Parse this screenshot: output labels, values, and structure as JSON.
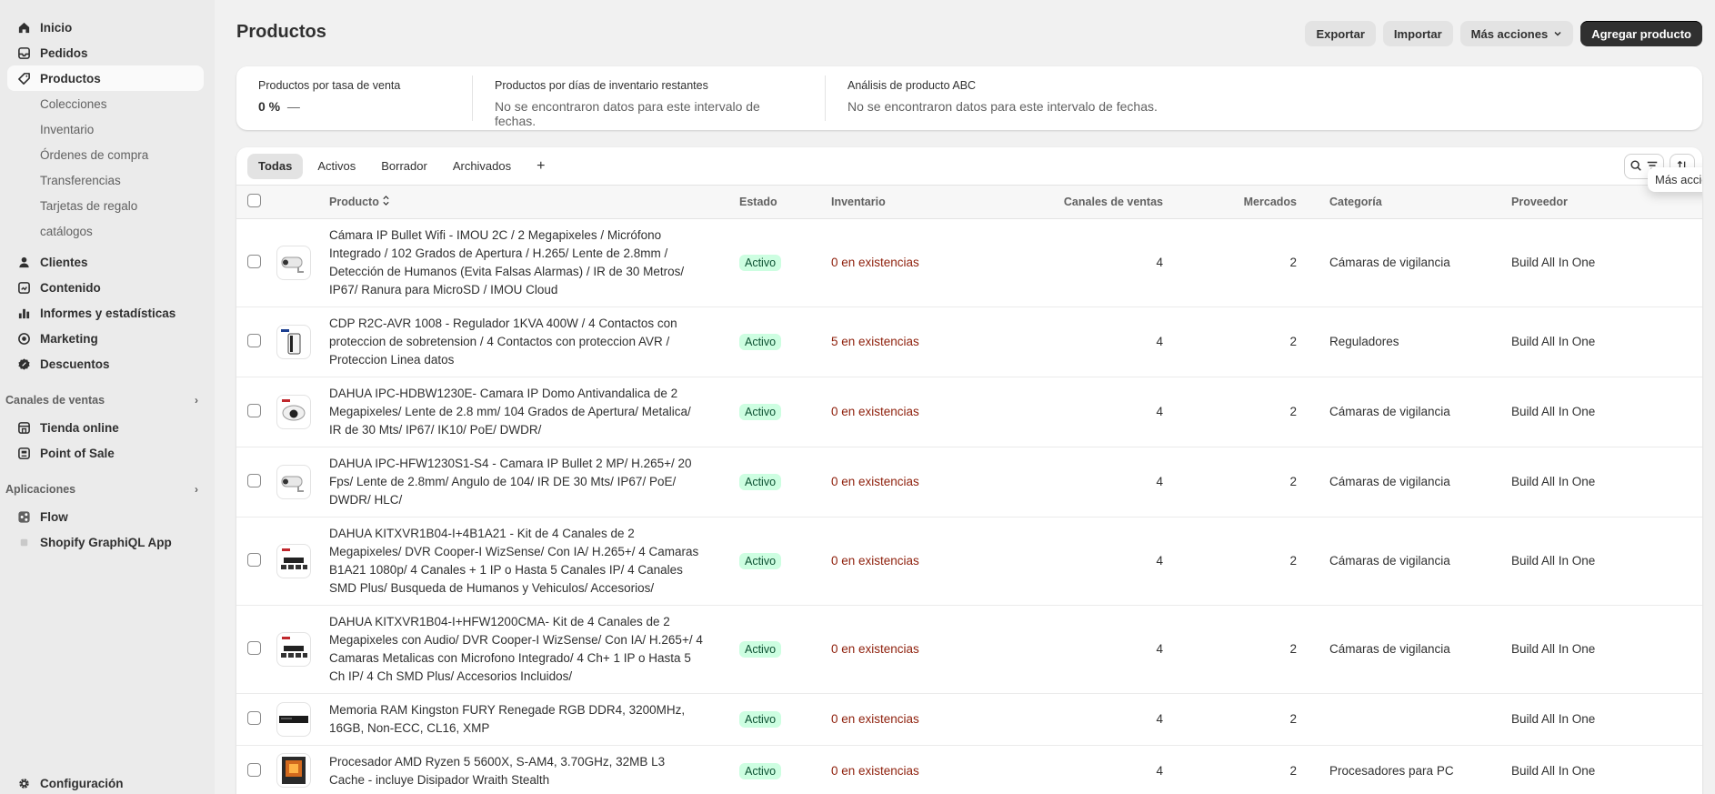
{
  "sidebar": {
    "top": [
      {
        "label": "Inicio",
        "icon": "home-icon"
      },
      {
        "label": "Pedidos",
        "icon": "inbox-icon"
      },
      {
        "label": "Productos",
        "icon": "tag-icon",
        "active": true
      }
    ],
    "products_sub": [
      "Colecciones",
      "Inventario",
      "Órdenes de compra",
      "Transferencias",
      "Tarjetas de regalo",
      "catálogos"
    ],
    "mid": [
      {
        "label": "Clientes",
        "icon": "person-icon"
      },
      {
        "label": "Contenido",
        "icon": "content-icon"
      },
      {
        "label": "Informes y estadísticas",
        "icon": "chart-icon"
      },
      {
        "label": "Marketing",
        "icon": "target-icon"
      },
      {
        "label": "Descuentos",
        "icon": "discount-icon"
      }
    ],
    "sales_channels_label": "Canales de ventas",
    "sales_channels": [
      {
        "label": "Tienda online",
        "icon": "store-icon"
      },
      {
        "label": "Point of Sale",
        "icon": "pos-icon"
      }
    ],
    "apps_label": "Aplicaciones",
    "apps": [
      {
        "label": "Flow",
        "icon": "flow-icon"
      },
      {
        "label": "Shopify GraphiQL App",
        "icon": "app-icon"
      }
    ],
    "settings_label": "Configuración"
  },
  "header": {
    "title": "Productos",
    "export": "Exportar",
    "import": "Importar",
    "more_actions": "Más acciones",
    "add_product": "Agregar producto"
  },
  "stats": {
    "sell_rate_label": "Productos por tasa de venta",
    "sell_rate_value": "0 %",
    "sell_rate_dash": "—",
    "days_label": "Productos por días de inventario restantes",
    "days_value": "No se encontraron datos para este intervalo de fechas.",
    "abc_label": "Análisis de producto ABC",
    "abc_value": "No se encontraron datos para este intervalo de fechas."
  },
  "tabs": [
    "Todas",
    "Activos",
    "Borrador",
    "Archivados",
    "+"
  ],
  "tooltip": "Más acciones",
  "columns": {
    "product": "Producto",
    "status": "Estado",
    "inventory": "Inventario",
    "channels": "Canales de ventas",
    "markets": "Mercados",
    "category": "Categoría",
    "vendor": "Proveedor"
  },
  "rows": [
    {
      "name": "Cámara IP Bullet Wifi - IMOU 2C / 2 Megapixeles / Micrófono Integrado / 102 Grados de Apertura / H.265/ Lente de 2.8mm / Detección de Humanos (Evita Falsas Alarmas) / IR de 30 Metros/ IP67/ Ranura para MicroSD / IMOU Cloud",
      "status": "Activo",
      "inventory": "0 en existencias",
      "channels": "4",
      "markets": "2",
      "category": "Cámaras de vigilancia",
      "vendor": "Build All In One",
      "thumb": "bullet-camera"
    },
    {
      "name": "CDP R2C-AVR 1008 - Regulador 1KVA 400W / 4 Contactos con proteccion de sobretension / 4 Contactos con proteccion AVR / Proteccion Linea datos",
      "status": "Activo",
      "inventory": "5 en existencias",
      "channels": "4",
      "markets": "2",
      "category": "Reguladores",
      "vendor": "Build All In One",
      "thumb": "regulator"
    },
    {
      "name": "DAHUA IPC-HDBW1230E- Camara IP Domo Antivandalica de 2 Megapixeles/ Lente de 2.8 mm/ 104 Grados de Apertura/ Metalica/ IR de 30 Mts/ IP67/ IK10/ PoE/ DWDR/",
      "status": "Activo",
      "inventory": "0 en existencias",
      "channels": "4",
      "markets": "2",
      "category": "Cámaras de vigilancia",
      "vendor": "Build All In One",
      "thumb": "dome-camera"
    },
    {
      "name": "DAHUA IPC-HFW1230S1-S4 - Camara IP Bullet 2 MP/ H.265+/ 20 Fps/ Lente de 2.8mm/ Angulo de 104/ IR DE 30 Mts/ IP67/ PoE/ DWDR/ HLC/",
      "status": "Activo",
      "inventory": "0 en existencias",
      "channels": "4",
      "markets": "2",
      "category": "Cámaras de vigilancia",
      "vendor": "Build All In One",
      "thumb": "bullet-camera"
    },
    {
      "name": "DAHUA KITXVR1B04-I+4B1A21 - Kit de 4 Canales de 2 Megapixeles/ DVR Cooper-I WizSense/ Con IA/ H.265+/ 4 Camaras B1A21 1080p/ 4 Canales + 1 IP o Hasta 5 Canales IP/ 4 Canales SMD Plus/ Busqueda de Humanos y Vehiculos/ Accesorios/",
      "status": "Activo",
      "inventory": "0 en existencias",
      "channels": "4",
      "markets": "2",
      "category": "Cámaras de vigilancia",
      "vendor": "Build All In One",
      "thumb": "kit"
    },
    {
      "name": "DAHUA KITXVR1B04-I+HFW1200CMA- Kit de 4 Canales de 2 Megapixeles con Audio/ DVR Cooper-I WizSense/ Con IA/ H.265+/ 4 Camaras Metalicas con Microfono Integrado/ 4 Ch+ 1 IP o Hasta 5 Ch IP/ 4 Ch SMD Plus/ Accesorios Incluidos/",
      "status": "Activo",
      "inventory": "0 en existencias",
      "channels": "4",
      "markets": "2",
      "category": "Cámaras de vigilancia",
      "vendor": "Build All In One",
      "thumb": "kit"
    },
    {
      "name": "Memoria RAM Kingston FURY Renegade RGB DDR4, 3200MHz, 16GB, Non-ECC, CL16, XMP",
      "status": "Activo",
      "inventory": "0 en existencias",
      "channels": "4",
      "markets": "2",
      "category": "",
      "vendor": "Build All In One",
      "thumb": "ram"
    },
    {
      "name": "Procesador AMD Ryzen 5 5600X, S-AM4, 3.70GHz, 32MB L3 Cache - incluye Disipador Wraith Stealth",
      "status": "Activo",
      "inventory": "0 en existencias",
      "channels": "4",
      "markets": "2",
      "category": "Procesadores para PC",
      "vendor": "Build All In One",
      "thumb": "cpu-box"
    }
  ]
}
